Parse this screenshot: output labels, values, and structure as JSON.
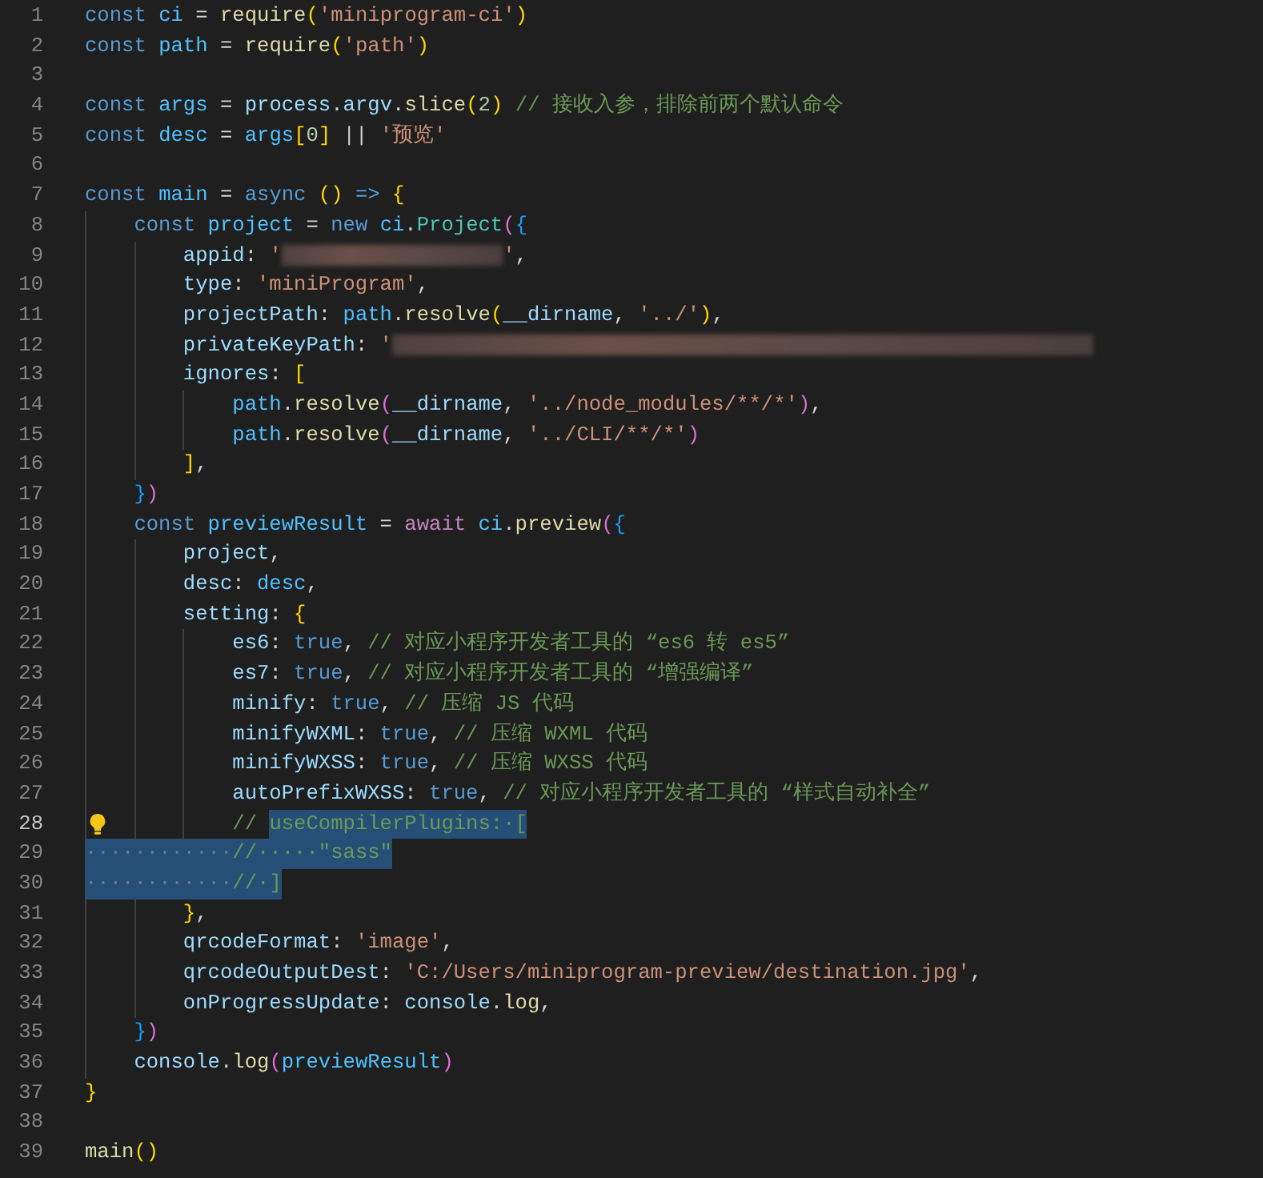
{
  "editor": {
    "lines": [
      {
        "n": "1",
        "current": false,
        "code": [
          {
            "text": "const ",
            "kind": "keyword"
          },
          {
            "text": "ci",
            "kind": "variable"
          },
          {
            "text": " = ",
            "kind": "plain"
          },
          {
            "text": "require",
            "kind": "function"
          },
          {
            "text": "(",
            "kind": "bracket1"
          },
          {
            "text": "'miniprogram-ci'",
            "kind": "string"
          },
          {
            "text": ")",
            "kind": "bracket1"
          }
        ]
      },
      {
        "n": "2",
        "current": false,
        "code": [
          {
            "text": "const ",
            "kind": "keyword"
          },
          {
            "text": "path",
            "kind": "variable"
          },
          {
            "text": " = ",
            "kind": "plain"
          },
          {
            "text": "require",
            "kind": "function"
          },
          {
            "text": "(",
            "kind": "bracket1"
          },
          {
            "text": "'path'",
            "kind": "string"
          },
          {
            "text": ")",
            "kind": "bracket1"
          }
        ]
      },
      {
        "n": "3",
        "current": false
      },
      {
        "n": "4",
        "current": false,
        "code": [
          {
            "text": "const ",
            "kind": "keyword"
          },
          {
            "text": "args",
            "kind": "variable"
          },
          {
            "text": " = ",
            "kind": "plain"
          },
          {
            "text": "process",
            "kind": "property"
          },
          {
            "text": ".",
            "kind": "plain"
          },
          {
            "text": "argv",
            "kind": "property"
          },
          {
            "text": ".",
            "kind": "plain"
          },
          {
            "text": "slice",
            "kind": "function"
          },
          {
            "text": "(",
            "kind": "bracket1"
          },
          {
            "text": "2",
            "kind": "number"
          },
          {
            "text": ")",
            "kind": "bracket1"
          },
          {
            "text": " // 接收入参，排除前两个默认命令",
            "kind": "comment"
          }
        ]
      },
      {
        "n": "5",
        "current": false,
        "code": [
          {
            "text": "const ",
            "kind": "keyword"
          },
          {
            "text": "desc",
            "kind": "variable"
          },
          {
            "text": " = ",
            "kind": "plain"
          },
          {
            "text": "args",
            "kind": "variable"
          },
          {
            "text": "[",
            "kind": "bracket1"
          },
          {
            "text": "0",
            "kind": "number"
          },
          {
            "text": "]",
            "kind": "bracket1"
          },
          {
            "text": " || ",
            "kind": "plain"
          },
          {
            "text": "'预览'",
            "kind": "string"
          }
        ]
      },
      {
        "n": "6",
        "current": false
      },
      {
        "n": "7",
        "current": false,
        "code": [
          {
            "text": "const ",
            "kind": "keyword"
          },
          {
            "text": "main",
            "kind": "variable"
          },
          {
            "text": " = ",
            "kind": "plain"
          },
          {
            "text": "async ",
            "kind": "keyword"
          },
          {
            "text": "() ",
            "kind": "bracket1"
          },
          {
            "text": "=> ",
            "kind": "keyword"
          },
          {
            "text": "{",
            "kind": "bracket1"
          }
        ]
      },
      {
        "n": "8",
        "current": false,
        "code": [
          {
            "text": "    const ",
            "kind": "keyword"
          },
          {
            "text": "project",
            "kind": "variable"
          },
          {
            "text": " = ",
            "kind": "plain"
          },
          {
            "text": "new ",
            "kind": "keyword"
          },
          {
            "text": "ci",
            "kind": "variable"
          },
          {
            "text": ".",
            "kind": "plain"
          },
          {
            "text": "Project",
            "kind": "type"
          },
          {
            "text": "(",
            "kind": "bracket2"
          },
          {
            "text": "{",
            "kind": "bracket3"
          }
        ]
      },
      {
        "n": "9",
        "current": false,
        "code": [
          {
            "text": "        appid",
            "kind": "property"
          },
          {
            "text": ": ",
            "kind": "plain"
          },
          {
            "text": "'",
            "kind": "string"
          },
          {
            "kind": "redacted"
          },
          {
            "text": "'",
            "kind": "string"
          },
          {
            "text": ",",
            "kind": "plain"
          }
        ]
      },
      {
        "n": "10",
        "current": false,
        "code": [
          {
            "text": "        type",
            "kind": "property"
          },
          {
            "text": ": ",
            "kind": "plain"
          },
          {
            "text": "'miniProgram'",
            "kind": "string"
          },
          {
            "text": ",",
            "kind": "plain"
          }
        ]
      },
      {
        "n": "11",
        "current": false,
        "code": [
          {
            "text": "        projectPath",
            "kind": "property"
          },
          {
            "text": ": ",
            "kind": "plain"
          },
          {
            "text": "path",
            "kind": "variable"
          },
          {
            "text": ".",
            "kind": "plain"
          },
          {
            "text": "resolve",
            "kind": "function"
          },
          {
            "text": "(",
            "kind": "bracket1"
          },
          {
            "text": "__dirname",
            "kind": "property"
          },
          {
            "text": ", ",
            "kind": "plain"
          },
          {
            "text": "'../'",
            "kind": "string"
          },
          {
            "text": ")",
            "kind": "bracket1"
          },
          {
            "text": ",",
            "kind": "plain"
          }
        ]
      },
      {
        "n": "12",
        "current": false,
        "code": [
          {
            "text": "        privateKeyPath",
            "kind": "property"
          },
          {
            "text": ": ",
            "kind": "plain"
          },
          {
            "text": "'",
            "kind": "string"
          },
          {
            "kind": "redacted"
          }
        ]
      },
      {
        "n": "13",
        "current": false,
        "code": [
          {
            "text": "        ignores",
            "kind": "property"
          },
          {
            "text": ": ",
            "kind": "plain"
          },
          {
            "text": "[",
            "kind": "bracket1"
          }
        ]
      },
      {
        "n": "14",
        "current": false,
        "code": [
          {
            "text": "            path",
            "kind": "variable"
          },
          {
            "text": ".",
            "kind": "plain"
          },
          {
            "text": "resolve",
            "kind": "function"
          },
          {
            "text": "(",
            "kind": "bracket2"
          },
          {
            "text": "__dirname",
            "kind": "property"
          },
          {
            "text": ", ",
            "kind": "plain"
          },
          {
            "text": "'../node_modules/**/*'",
            "kind": "string"
          },
          {
            "text": ")",
            "kind": "bracket2"
          },
          {
            "text": ",",
            "kind": "plain"
          }
        ]
      },
      {
        "n": "15",
        "current": false,
        "code": [
          {
            "text": "            path",
            "kind": "variable"
          },
          {
            "text": ".",
            "kind": "plain"
          },
          {
            "text": "resolve",
            "kind": "function"
          },
          {
            "text": "(",
            "kind": "bracket2"
          },
          {
            "text": "__dirname",
            "kind": "property"
          },
          {
            "text": ", ",
            "kind": "plain"
          },
          {
            "text": "'../CLI/**/*'",
            "kind": "string"
          },
          {
            "text": ")",
            "kind": "bracket2"
          }
        ]
      },
      {
        "n": "16",
        "current": false,
        "code": [
          {
            "text": "        ]",
            "kind": "bracket1"
          },
          {
            "text": ",",
            "kind": "plain"
          }
        ]
      },
      {
        "n": "17",
        "current": false,
        "code": [
          {
            "text": "    }",
            "kind": "bracket3"
          },
          {
            "text": ")",
            "kind": "bracket2"
          }
        ]
      },
      {
        "n": "18",
        "current": false,
        "code": [
          {
            "text": "    const ",
            "kind": "keyword"
          },
          {
            "text": "previewResult",
            "kind": "variable"
          },
          {
            "text": " = ",
            "kind": "plain"
          },
          {
            "text": "await ",
            "kind": "control"
          },
          {
            "text": "ci",
            "kind": "variable"
          },
          {
            "text": ".",
            "kind": "plain"
          },
          {
            "text": "preview",
            "kind": "function"
          },
          {
            "text": "(",
            "kind": "bracket2"
          },
          {
            "text": "{",
            "kind": "bracket3"
          }
        ]
      },
      {
        "n": "19",
        "current": false,
        "code": [
          {
            "text": "        project",
            "kind": "property"
          },
          {
            "text": ",",
            "kind": "plain"
          }
        ]
      },
      {
        "n": "20",
        "current": false,
        "code": [
          {
            "text": "        desc",
            "kind": "property"
          },
          {
            "text": ": ",
            "kind": "plain"
          },
          {
            "text": "desc",
            "kind": "variable"
          },
          {
            "text": ",",
            "kind": "plain"
          }
        ]
      },
      {
        "n": "21",
        "current": false,
        "code": [
          {
            "text": "        setting",
            "kind": "property"
          },
          {
            "text": ": ",
            "kind": "plain"
          },
          {
            "text": "{",
            "kind": "bracket1"
          }
        ]
      },
      {
        "n": "22",
        "current": false,
        "code": [
          {
            "text": "            es6",
            "kind": "property"
          },
          {
            "text": ": ",
            "kind": "plain"
          },
          {
            "text": "true",
            "kind": "keyword"
          },
          {
            "text": ", ",
            "kind": "plain"
          },
          {
            "text": "// 对应小程序开发者工具的 “es6 转 es5”",
            "kind": "comment"
          }
        ]
      },
      {
        "n": "23",
        "current": false,
        "code": [
          {
            "text": "            es7",
            "kind": "property"
          },
          {
            "text": ": ",
            "kind": "plain"
          },
          {
            "text": "true",
            "kind": "keyword"
          },
          {
            "text": ", ",
            "kind": "plain"
          },
          {
            "text": "// 对应小程序开发者工具的 “增强编译”",
            "kind": "comment"
          }
        ]
      },
      {
        "n": "24",
        "current": false,
        "code": [
          {
            "text": "            minify",
            "kind": "property"
          },
          {
            "text": ": ",
            "kind": "plain"
          },
          {
            "text": "true",
            "kind": "keyword"
          },
          {
            "text": ", ",
            "kind": "plain"
          },
          {
            "text": "// 压缩 JS 代码",
            "kind": "comment"
          }
        ]
      },
      {
        "n": "25",
        "current": false,
        "code": [
          {
            "text": "            minifyWXML",
            "kind": "property"
          },
          {
            "text": ": ",
            "kind": "plain"
          },
          {
            "text": "true",
            "kind": "keyword"
          },
          {
            "text": ", ",
            "kind": "plain"
          },
          {
            "text": "// 压缩 WXML 代码",
            "kind": "comment"
          }
        ]
      },
      {
        "n": "26",
        "current": false,
        "code": [
          {
            "text": "            minifyWXSS",
            "kind": "property"
          },
          {
            "text": ": ",
            "kind": "plain"
          },
          {
            "text": "true",
            "kind": "keyword"
          },
          {
            "text": ", ",
            "kind": "plain"
          },
          {
            "text": "// 压缩 WXSS 代码",
            "kind": "comment"
          }
        ]
      },
      {
        "n": "27",
        "current": false,
        "code": [
          {
            "text": "            autoPrefixWXSS",
            "kind": "property"
          },
          {
            "text": ": ",
            "kind": "plain"
          },
          {
            "text": "true",
            "kind": "keyword"
          },
          {
            "text": ", ",
            "kind": "plain"
          },
          {
            "text": "// 对应小程序开发者工具的 “样式自动补全”",
            "kind": "comment"
          }
        ]
      },
      {
        "n": "28",
        "current": true,
        "hint": true,
        "code": [
          {
            "text": "            // ",
            "kind": "comment"
          }
        ],
        "selected": [
          {
            "text": "useCompilerPlugins:·[",
            "kind": "comment"
          }
        ]
      },
      {
        "n": "29",
        "current": false,
        "selected": [
          {
            "text": "············",
            "kind": "whitespace"
          },
          {
            "text": "//·····\"sass\"",
            "kind": "comment"
          }
        ]
      },
      {
        "n": "30",
        "current": false,
        "selected": [
          {
            "text": "············",
            "kind": "whitespace"
          },
          {
            "text": "//·]",
            "kind": "comment"
          }
        ]
      },
      {
        "n": "31",
        "current": false,
        "code": [
          {
            "text": "        }",
            "kind": "bracket1"
          },
          {
            "text": ",",
            "kind": "plain"
          }
        ]
      },
      {
        "n": "32",
        "current": false,
        "code": [
          {
            "text": "        qrcodeFormat",
            "kind": "property"
          },
          {
            "text": ": ",
            "kind": "plain"
          },
          {
            "text": "'image'",
            "kind": "string"
          },
          {
            "text": ",",
            "kind": "plain"
          }
        ]
      },
      {
        "n": "33",
        "current": false,
        "code": [
          {
            "text": "        qrcodeOutputDest",
            "kind": "property"
          },
          {
            "text": ": ",
            "kind": "plain"
          },
          {
            "text": "'C:/Users/miniprogram-preview/destination.jpg'",
            "kind": "string"
          },
          {
            "text": ",",
            "kind": "plain"
          }
        ]
      },
      {
        "n": "34",
        "current": false,
        "code": [
          {
            "text": "        onProgressUpdate",
            "kind": "property"
          },
          {
            "text": ": ",
            "kind": "plain"
          },
          {
            "text": "console",
            "kind": "property"
          },
          {
            "text": ".",
            "kind": "plain"
          },
          {
            "text": "log",
            "kind": "function"
          },
          {
            "text": ",",
            "kind": "plain"
          }
        ]
      },
      {
        "n": "35",
        "current": false,
        "code": [
          {
            "text": "    }",
            "kind": "bracket3"
          },
          {
            "text": ")",
            "kind": "bracket2"
          }
        ]
      },
      {
        "n": "36",
        "current": false,
        "code": [
          {
            "text": "    console",
            "kind": "property"
          },
          {
            "text": ".",
            "kind": "plain"
          },
          {
            "text": "log",
            "kind": "function"
          },
          {
            "text": "(",
            "kind": "bracket2"
          },
          {
            "text": "previewResult",
            "kind": "variable"
          },
          {
            "text": ")",
            "kind": "bracket2"
          }
        ]
      },
      {
        "n": "37",
        "current": false,
        "code": [
          {
            "text": "}",
            "kind": "bracket1"
          }
        ]
      },
      {
        "n": "38",
        "current": false
      },
      {
        "n": "39",
        "current": false,
        "code": [
          {
            "text": "main",
            "kind": "function"
          },
          {
            "text": "()",
            "kind": "bracket1"
          }
        ]
      }
    ]
  }
}
